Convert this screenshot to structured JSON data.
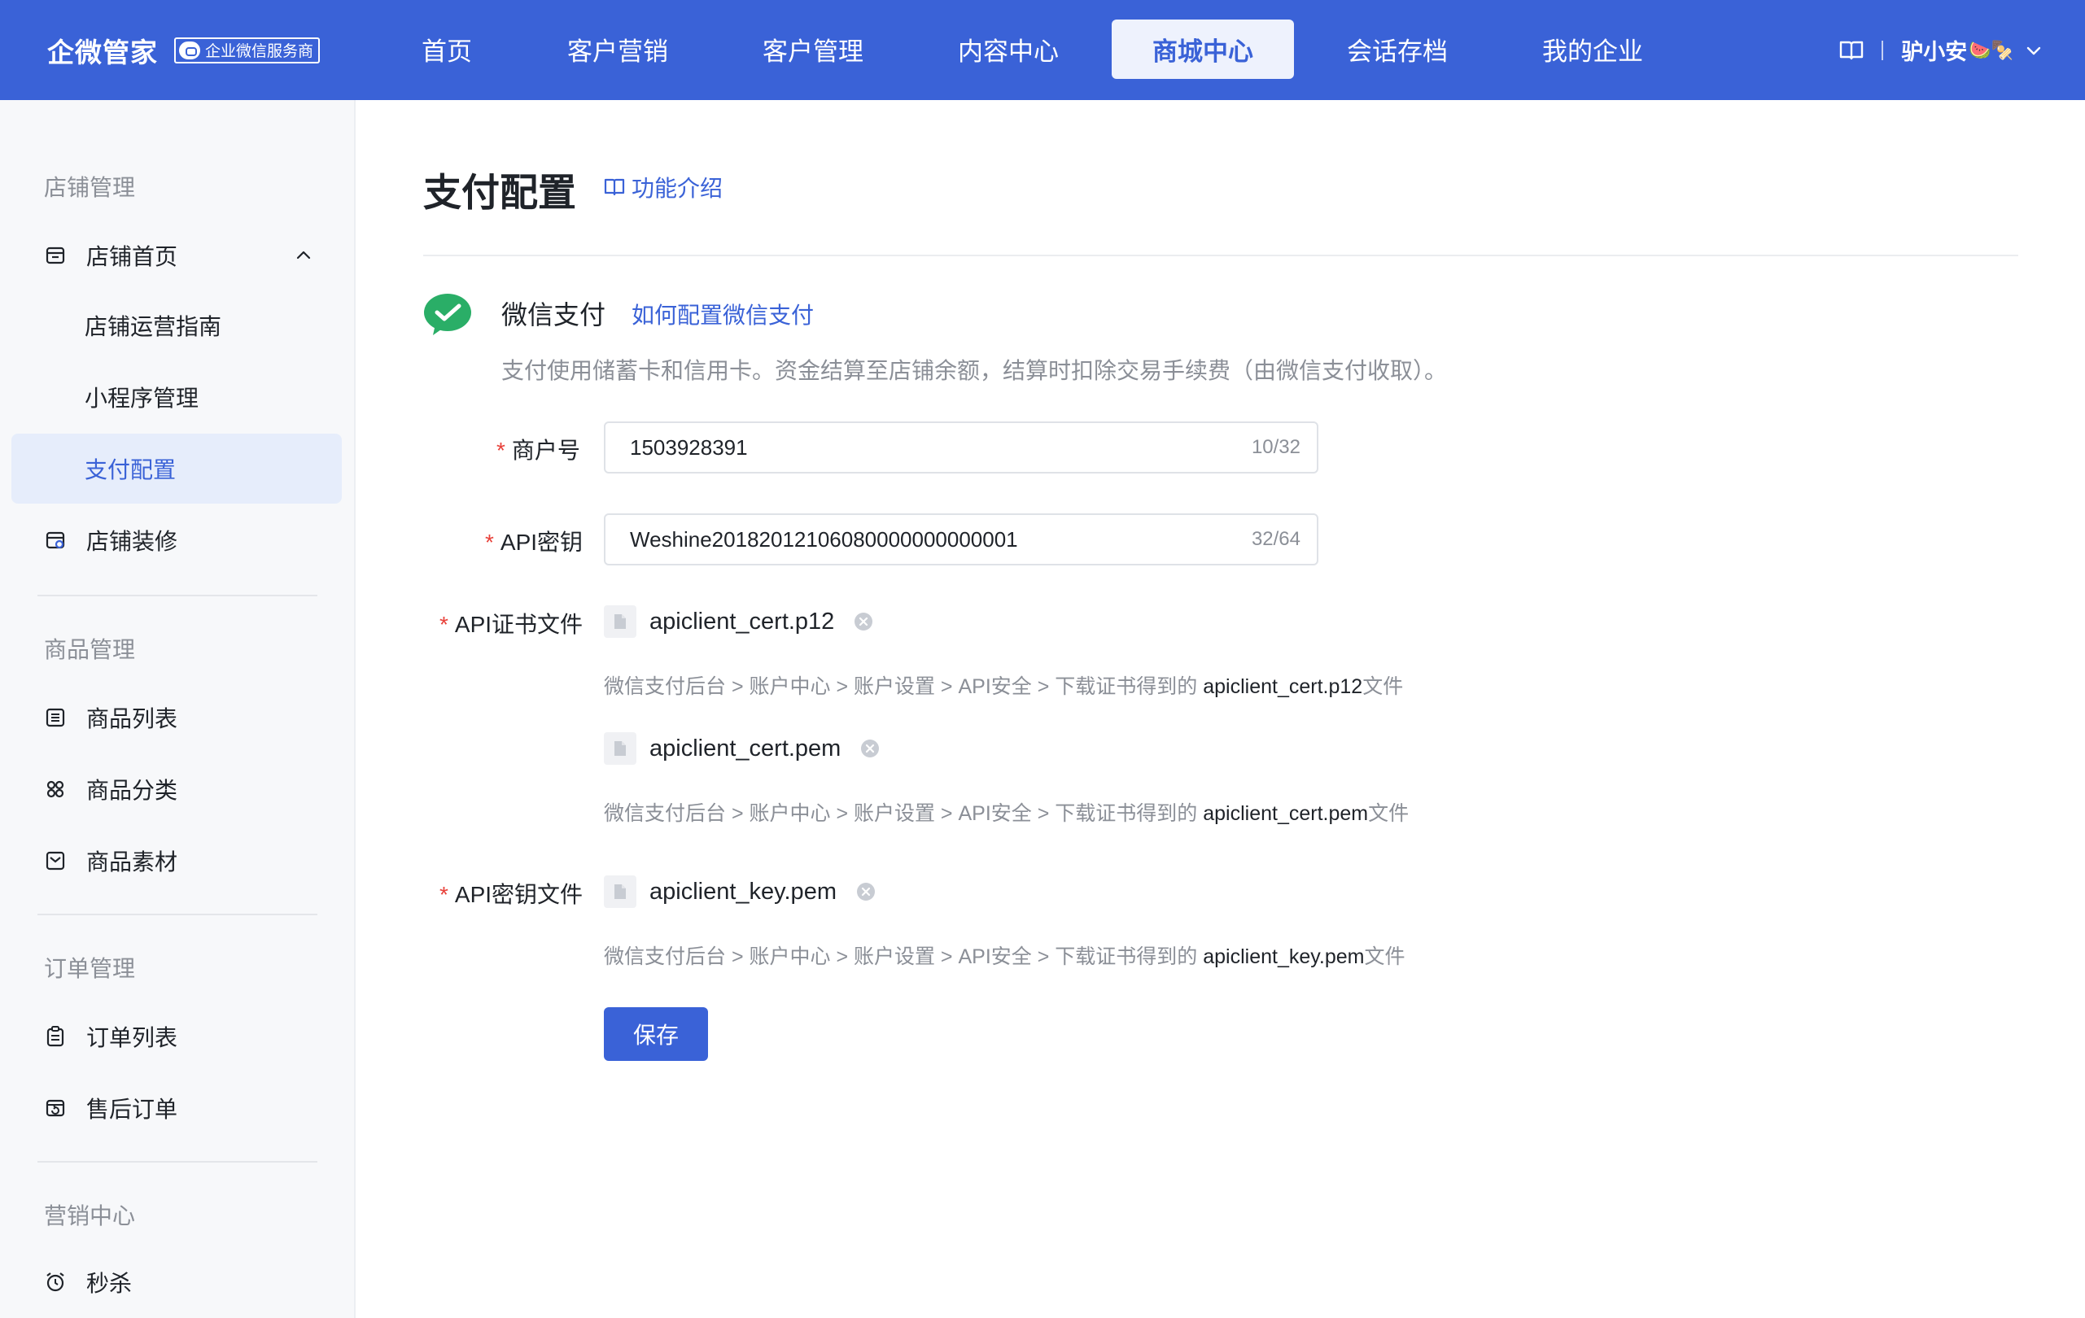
{
  "header": {
    "brand_name": "企微管家",
    "brand_badge": "企业微信服务商",
    "nav": [
      {
        "label": "首页"
      },
      {
        "label": "客户营销"
      },
      {
        "label": "客户管理"
      },
      {
        "label": "内容中心"
      },
      {
        "label": "商城中心"
      },
      {
        "label": "会话存档"
      },
      {
        "label": "我的企业"
      }
    ],
    "active_nav": "商城中心",
    "user_name": "驴小安",
    "user_emoji": "🍉🍢"
  },
  "sidebar": {
    "groups": [
      {
        "title": "店铺管理"
      },
      {
        "title": "商品管理"
      },
      {
        "title": "订单管理"
      },
      {
        "title": "营销中心"
      }
    ],
    "items": [
      {
        "label": "店铺首页",
        "icon": "store-icon"
      },
      {
        "label": "店铺运营指南"
      },
      {
        "label": "小程序管理"
      },
      {
        "label": "支付配置"
      },
      {
        "label": "店铺装修",
        "icon": "decoration-icon"
      },
      {
        "label": "商品列表",
        "icon": "list-icon"
      },
      {
        "label": "商品分类",
        "icon": "category-icon"
      },
      {
        "label": "商品素材",
        "icon": "material-icon"
      },
      {
        "label": "订单列表",
        "icon": "order-icon"
      },
      {
        "label": "售后订单",
        "icon": "aftersale-icon"
      },
      {
        "label": "秒杀",
        "icon": "alarm-icon"
      }
    ],
    "active_item": "支付配置"
  },
  "main": {
    "title": "支付配置",
    "intro_link": "功能介绍",
    "wechat_pay": {
      "title": "微信支付",
      "howto_link": "如何配置微信支付",
      "description": "支付使用储蓄卡和信用卡。资金结算至店铺余额，结算时扣除交易手续费（由微信支付收取）。"
    },
    "form": {
      "merchant_id": {
        "label": "商户号",
        "value": "1503928391",
        "count": "10/32"
      },
      "api_key": {
        "label": "API密钥",
        "value": "Weshine20182012106080000000000001",
        "count": "32/64"
      },
      "cert_file": {
        "label": "API证书文件",
        "files": [
          {
            "name": "apiclient_cert.p12",
            "hint_prefix": "微信支付后台 > 账户中心 > 账户设置 > API安全 > 下载证书得到的 ",
            "hint_file": "apiclient_cert.p12",
            "hint_suffix": "文件"
          },
          {
            "name": "apiclient_cert.pem",
            "hint_prefix": "微信支付后台 > 账户中心 > 账户设置 > API安全 > 下载证书得到的 ",
            "hint_file": "apiclient_cert.pem",
            "hint_suffix": "文件"
          }
        ]
      },
      "key_file": {
        "label": "API密钥文件",
        "files": [
          {
            "name": "apiclient_key.pem",
            "hint_prefix": "微信支付后台 > 账户中心 > 账户设置 > API安全 > 下载证书得到的 ",
            "hint_file": "apiclient_key.pem",
            "hint_suffix": "文件"
          }
        ]
      },
      "save_label": "保存"
    }
  },
  "colors": {
    "primary": "#3a62d7",
    "required": "#e8413a",
    "wechat_green": "#2aae67"
  }
}
